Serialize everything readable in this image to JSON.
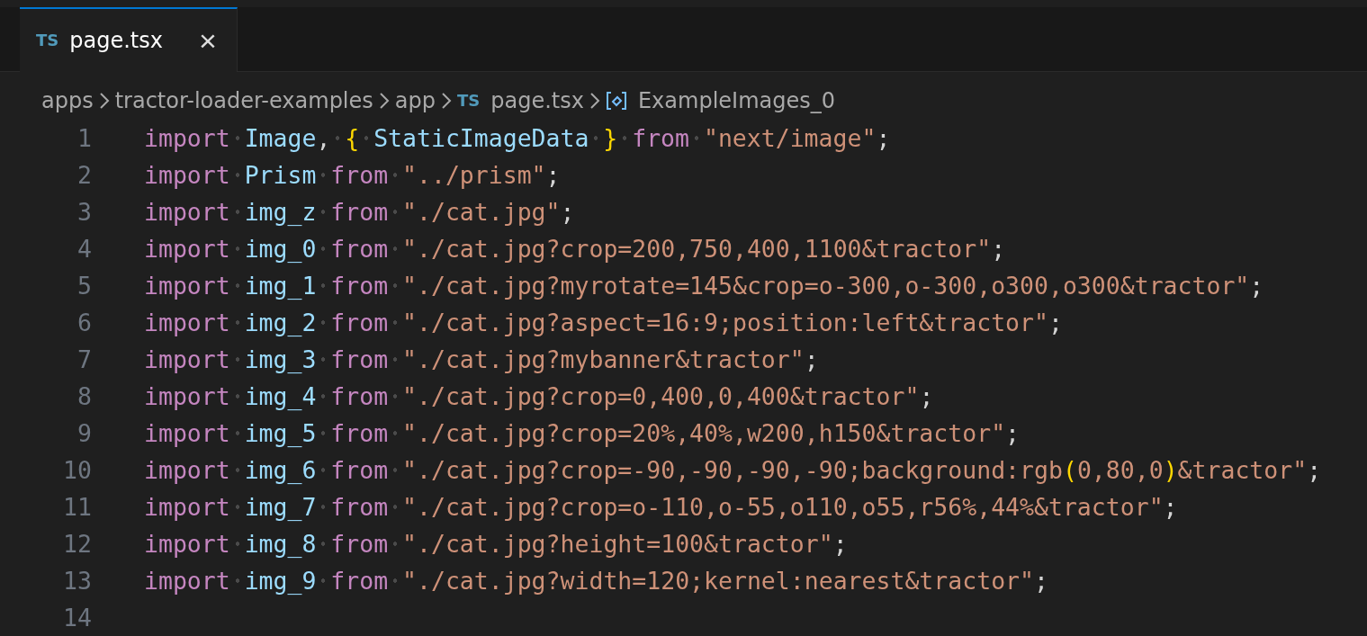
{
  "tabs": [
    {
      "badge": "TS",
      "label": "page.tsx",
      "close": "×",
      "selected": true
    }
  ],
  "breadcrumbs": [
    {
      "kind": "folder",
      "label": "apps"
    },
    {
      "kind": "folder",
      "label": "tractor-loader-examples"
    },
    {
      "kind": "folder",
      "label": "app"
    },
    {
      "kind": "file",
      "badge": "TS",
      "label": "page.tsx"
    },
    {
      "kind": "symbol",
      "label": "ExampleImages_0"
    }
  ],
  "lines": [
    {
      "number": "1",
      "tokens": [
        {
          "kind": "kw",
          "t": "import",
          "sp": true
        },
        {
          "kind": "var",
          "t": "Image"
        },
        {
          "kind": "punct",
          "t": ",",
          "sp": true
        },
        {
          "kind": "brace",
          "t": "{",
          "sp": true
        },
        {
          "kind": "var",
          "t": "StaticImageData",
          "sp": true
        },
        {
          "kind": "brace",
          "t": "}",
          "sp": true
        },
        {
          "kind": "kw",
          "t": "from",
          "sp": true
        },
        {
          "kind": "str",
          "t": "\"next/image\""
        },
        {
          "kind": "punct",
          "t": ";"
        }
      ]
    },
    {
      "number": "2",
      "tokens": [
        {
          "kind": "kw",
          "t": "import",
          "sp": true
        },
        {
          "kind": "var",
          "t": "Prism",
          "sp": true
        },
        {
          "kind": "kw",
          "t": "from",
          "sp": true
        },
        {
          "kind": "str",
          "t": "\"../prism\""
        },
        {
          "kind": "punct",
          "t": ";"
        }
      ]
    },
    {
      "number": "3",
      "tokens": [
        {
          "kind": "kw",
          "t": "import",
          "sp": true
        },
        {
          "kind": "var",
          "t": "img_z",
          "sp": true
        },
        {
          "kind": "kw",
          "t": "from",
          "sp": true
        },
        {
          "kind": "str",
          "t": "\"./cat.jpg\""
        },
        {
          "kind": "punct",
          "t": ";"
        }
      ]
    },
    {
      "number": "4",
      "tokens": [
        {
          "kind": "kw",
          "t": "import",
          "sp": true
        },
        {
          "kind": "var",
          "t": "img_0",
          "sp": true
        },
        {
          "kind": "kw",
          "t": "from",
          "sp": true
        },
        {
          "kind": "str",
          "t": "\"./cat.jpg?crop=200,750,400,1100&tractor\""
        },
        {
          "kind": "punct",
          "t": ";"
        }
      ]
    },
    {
      "number": "5",
      "tokens": [
        {
          "kind": "kw",
          "t": "import",
          "sp": true
        },
        {
          "kind": "var",
          "t": "img_1",
          "sp": true
        },
        {
          "kind": "kw",
          "t": "from",
          "sp": true
        },
        {
          "kind": "str",
          "t": "\"./cat.jpg?myrotate=145&crop=o-300,o-300,o300,o300&tractor\""
        },
        {
          "kind": "punct",
          "t": ";"
        }
      ]
    },
    {
      "number": "6",
      "tokens": [
        {
          "kind": "kw",
          "t": "import",
          "sp": true
        },
        {
          "kind": "var",
          "t": "img_2",
          "sp": true
        },
        {
          "kind": "kw",
          "t": "from",
          "sp": true
        },
        {
          "kind": "str",
          "t": "\"./cat.jpg?aspect=16:9;position:left&tractor\""
        },
        {
          "kind": "punct",
          "t": ";"
        }
      ]
    },
    {
      "number": "7",
      "tokens": [
        {
          "kind": "kw",
          "t": "import",
          "sp": true
        },
        {
          "kind": "var",
          "t": "img_3",
          "sp": true
        },
        {
          "kind": "kw",
          "t": "from",
          "sp": true
        },
        {
          "kind": "str",
          "t": "\"./cat.jpg?mybanner&tractor\""
        },
        {
          "kind": "punct",
          "t": ";"
        }
      ]
    },
    {
      "number": "8",
      "tokens": [
        {
          "kind": "kw",
          "t": "import",
          "sp": true
        },
        {
          "kind": "var",
          "t": "img_4",
          "sp": true
        },
        {
          "kind": "kw",
          "t": "from",
          "sp": true
        },
        {
          "kind": "str",
          "t": "\"./cat.jpg?crop=0,400,0,400&tractor\""
        },
        {
          "kind": "punct",
          "t": ";"
        }
      ]
    },
    {
      "number": "9",
      "tokens": [
        {
          "kind": "kw",
          "t": "import",
          "sp": true
        },
        {
          "kind": "var",
          "t": "img_5",
          "sp": true
        },
        {
          "kind": "kw",
          "t": "from",
          "sp": true
        },
        {
          "kind": "str",
          "t": "\"./cat.jpg?crop=20%,40%,w200,h150&tractor\""
        },
        {
          "kind": "punct",
          "t": ";"
        }
      ]
    },
    {
      "number": "10",
      "tokens": [
        {
          "kind": "kw",
          "t": "import",
          "sp": true
        },
        {
          "kind": "var",
          "t": "img_6",
          "sp": true
        },
        {
          "kind": "kw",
          "t": "from",
          "sp": true
        },
        {
          "kind": "str",
          "t": "\"./cat.jpg?crop=-90,-90,-90,-90;background:rgb"
        },
        {
          "kind": "brace",
          "t": "("
        },
        {
          "kind": "str",
          "t": "0,80,0"
        },
        {
          "kind": "brace",
          "t": ")"
        },
        {
          "kind": "str",
          "t": "&tractor\""
        },
        {
          "kind": "punct",
          "t": ";"
        }
      ]
    },
    {
      "number": "11",
      "tokens": [
        {
          "kind": "kw",
          "t": "import",
          "sp": true
        },
        {
          "kind": "var",
          "t": "img_7",
          "sp": true
        },
        {
          "kind": "kw",
          "t": "from",
          "sp": true
        },
        {
          "kind": "str",
          "t": "\"./cat.jpg?crop=o-110,o-55,o110,o55,r56%,44%&tractor\""
        },
        {
          "kind": "punct",
          "t": ";"
        }
      ]
    },
    {
      "number": "12",
      "tokens": [
        {
          "kind": "kw",
          "t": "import",
          "sp": true
        },
        {
          "kind": "var",
          "t": "img_8",
          "sp": true
        },
        {
          "kind": "kw",
          "t": "from",
          "sp": true
        },
        {
          "kind": "str",
          "t": "\"./cat.jpg?height=100&tractor\""
        },
        {
          "kind": "punct",
          "t": ";"
        }
      ]
    },
    {
      "number": "13",
      "tokens": [
        {
          "kind": "kw",
          "t": "import",
          "sp": true
        },
        {
          "kind": "var",
          "t": "img_9",
          "sp": true
        },
        {
          "kind": "kw",
          "t": "from",
          "sp": true
        },
        {
          "kind": "str",
          "t": "\"./cat.jpg?width=120;kernel:nearest&tractor\""
        },
        {
          "kind": "punct",
          "t": ";"
        }
      ]
    },
    {
      "number": "14"
    }
  ]
}
